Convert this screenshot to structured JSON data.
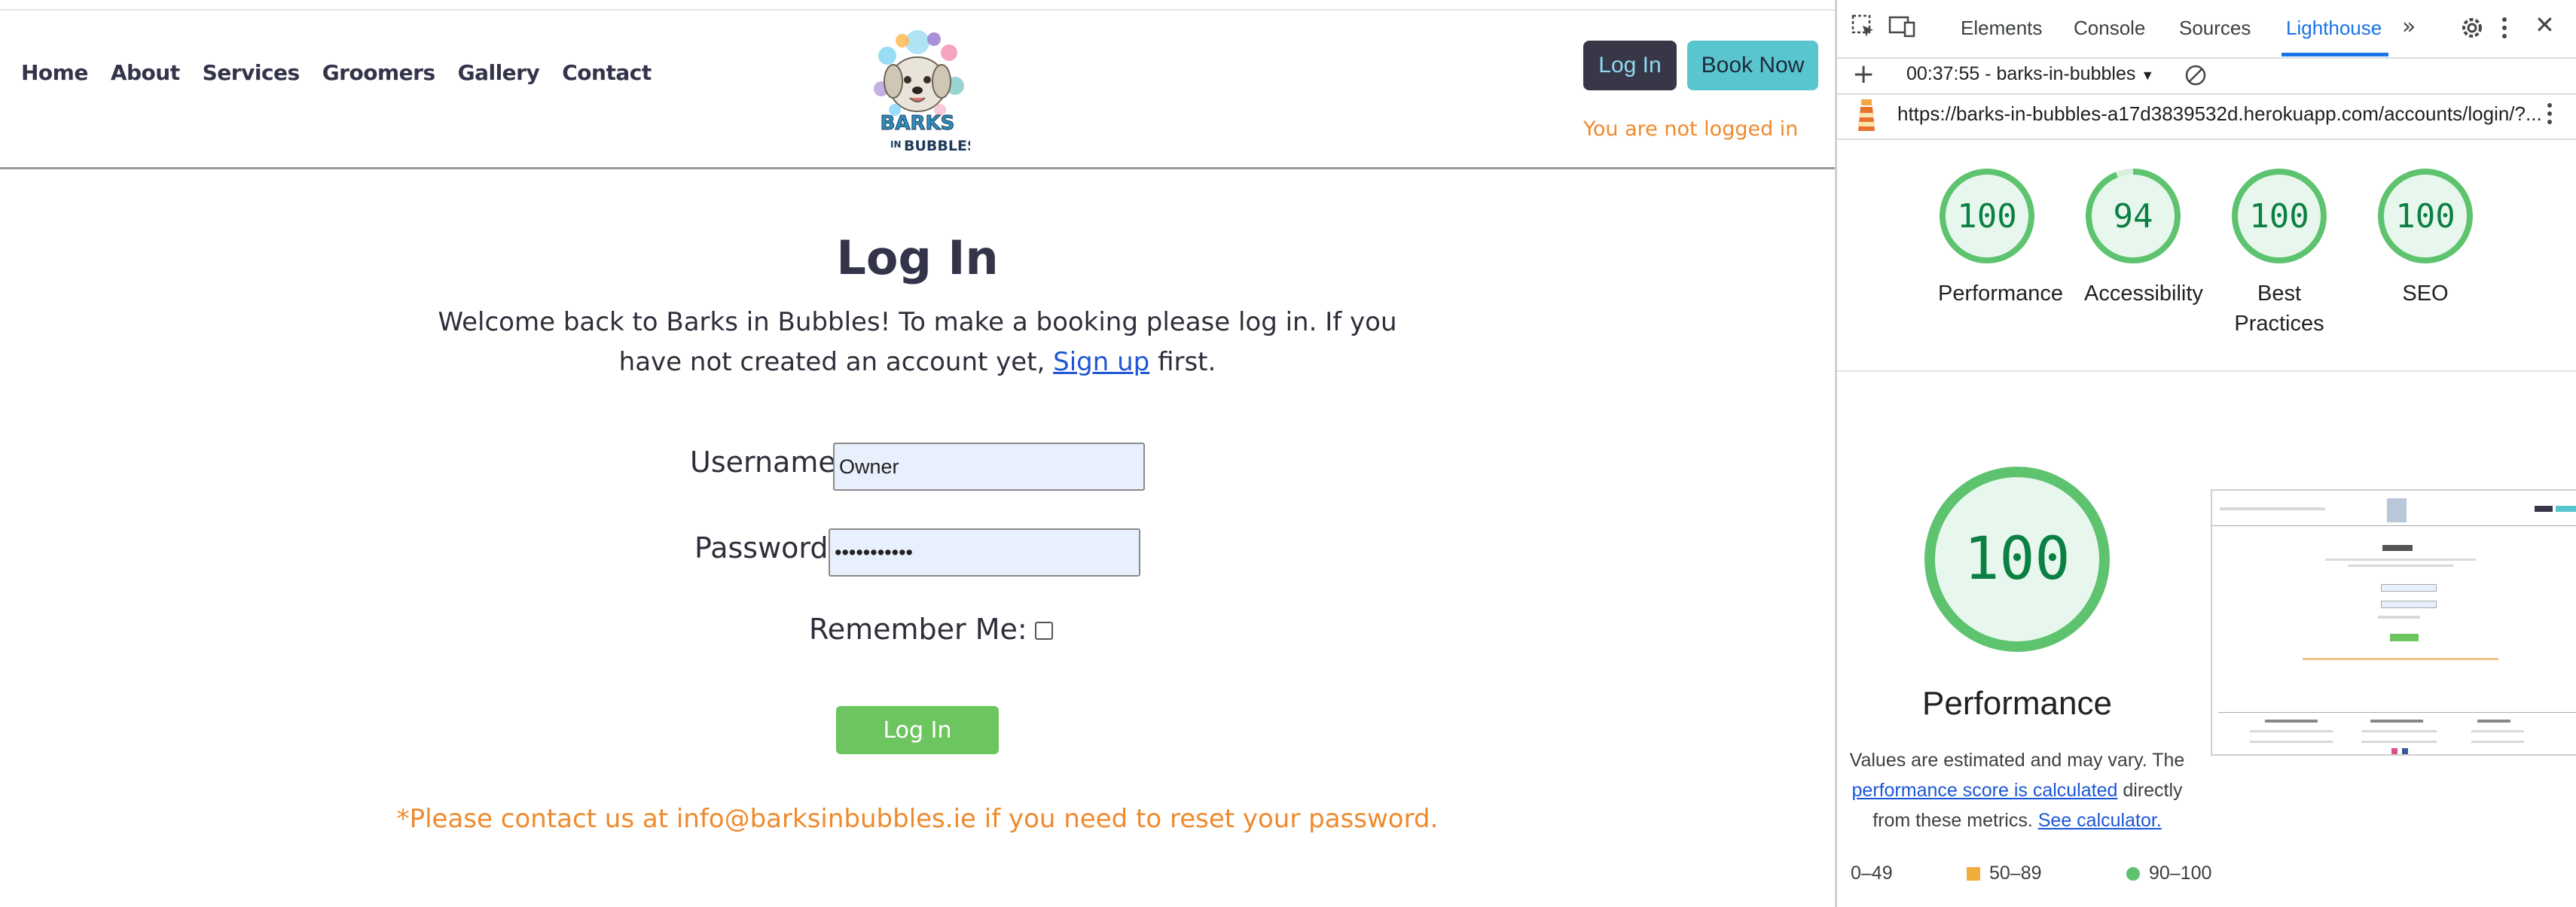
{
  "site": {
    "nav": [
      "Home",
      "About",
      "Services",
      "Groomers",
      "Gallery",
      "Contact"
    ],
    "logo_text": "BARKS IN BUBBLES",
    "login_button": "Log In",
    "book_button": "Book Now",
    "login_status": "You are not logged in",
    "title": "Log In",
    "intro_before": "Welcome back to Barks in Bubbles! To make a booking please log in. If you have not created an account yet,",
    "signup_link": "Sign up",
    "intro_after": "first.",
    "username_label": "Username:",
    "username_value": "Owner",
    "password_label": "Password:",
    "password_value": "•••••••••••",
    "remember_label": "Remember Me:",
    "submit_button": "Log In",
    "reset_note": "*Please contact us at info@barksinbubbles.ie if you need to reset your password."
  },
  "devtools": {
    "tabs": [
      "Elements",
      "Console",
      "Sources",
      "Lighthouse"
    ],
    "active_tab": "Lighthouse",
    "report_selector": "00:37:55 - barks-in-bubbles",
    "url": "https://barks-in-bubbles-a17d3839532d.herokuapp.com/accounts/login/?...",
    "scores": [
      {
        "label": "Performance",
        "value": 100
      },
      {
        "label": "Accessibility",
        "value": 94
      },
      {
        "label": "Best Practices",
        "value": 100
      },
      {
        "label": "SEO",
        "value": 100
      }
    ],
    "main_score": 100,
    "main_label": "Performance",
    "note_before": "Values are estimated and may vary. The",
    "note_link1": "performance score is calculated",
    "note_middle": "directly from these metrics.",
    "note_link2": "See calculator.",
    "legend": [
      "0–49",
      "50–89",
      "90–100"
    ],
    "colors": {
      "pass": "#0cce6b",
      "average": "#ffa400",
      "fail": "#ff4e42",
      "accent": "#1a73e8"
    }
  }
}
